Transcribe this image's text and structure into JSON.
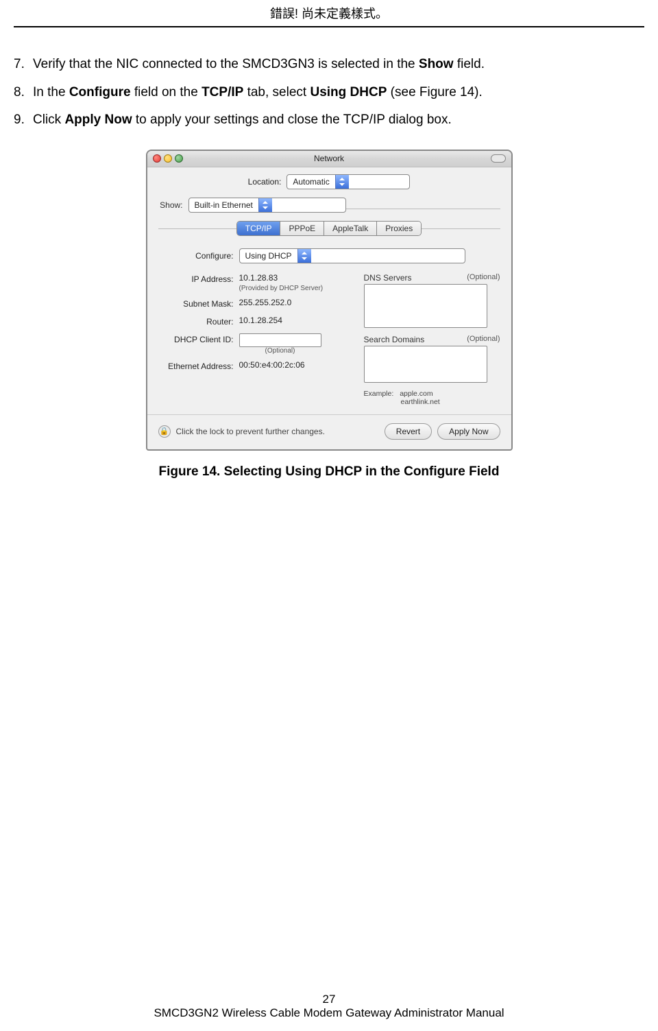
{
  "header": {
    "title": "錯誤! 尚未定義樣式。"
  },
  "steps": [
    {
      "num": "7.",
      "parts": [
        {
          "t": "Verify that the NIC connected to the SMCD3GN3 is selected in the ",
          "b": false
        },
        {
          "t": "Show",
          "b": true
        },
        {
          "t": " field.",
          "b": false
        }
      ]
    },
    {
      "num": "8.",
      "parts": [
        {
          "t": "In the ",
          "b": false
        },
        {
          "t": "Configure",
          "b": true
        },
        {
          "t": " field on the ",
          "b": false
        },
        {
          "t": "TCP/IP",
          "b": true
        },
        {
          "t": " tab, select ",
          "b": false
        },
        {
          "t": "Using DHCP",
          "b": true
        },
        {
          "t": " (see Figure 14).",
          "b": false
        }
      ]
    },
    {
      "num": "9.",
      "parts": [
        {
          "t": "Click ",
          "b": false
        },
        {
          "t": "Apply Now",
          "b": true
        },
        {
          "t": " to apply your settings and close the TCP/IP dialog box.",
          "b": false
        }
      ]
    }
  ],
  "window": {
    "title": "Network",
    "location_label": "Location:",
    "location_value": "Automatic",
    "show_label": "Show:",
    "show_value": "Built-in Ethernet",
    "tabs": [
      "TCP/IP",
      "PPPoE",
      "AppleTalk",
      "Proxies"
    ],
    "active_tab_index": 0,
    "configure_label": "Configure:",
    "configure_value": "Using DHCP",
    "left_fields": {
      "ip_label": "IP Address:",
      "ip_value": "10.1.28.83",
      "ip_hint": "(Provided by DHCP Server)",
      "subnet_label": "Subnet Mask:",
      "subnet_value": "255.255.252.0",
      "router_label": "Router:",
      "router_value": "10.1.28.254",
      "dhcpid_label": "DHCP Client ID:",
      "dhcpid_hint": "(Optional)",
      "eth_label": "Ethernet Address:",
      "eth_value": "00:50:e4:00:2c:06"
    },
    "right_fields": {
      "dns_label": "DNS Servers",
      "dns_opt": "(Optional)",
      "search_label": "Search Domains",
      "search_opt": "(Optional)",
      "example_label": "Example:",
      "example_line1": "apple.com",
      "example_line2": "earthlink.net"
    },
    "footer": {
      "lock_text": "Click the lock to prevent further changes.",
      "revert": "Revert",
      "apply": "Apply Now"
    }
  },
  "figure_caption": "Figure 14. Selecting Using DHCP in the Configure Field",
  "page_footer": {
    "page_num": "27",
    "manual": "SMCD3GN2 Wireless Cable Modem Gateway Administrator Manual"
  }
}
